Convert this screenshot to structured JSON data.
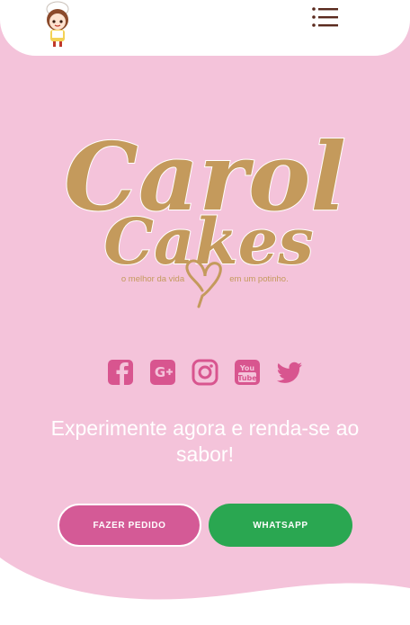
{
  "header": {
    "mascot_icon": "chef-girl-mascot-icon",
    "menu_icon": "list-menu-icon"
  },
  "logo": {
    "line1": "Carol",
    "line2": "Cakes",
    "slogan_left": "o melhor da vida",
    "slogan_right": "em um potinho."
  },
  "social": [
    {
      "name": "facebook-icon"
    },
    {
      "name": "google-plus-icon"
    },
    {
      "name": "instagram-icon"
    },
    {
      "name": "youtube-icon"
    },
    {
      "name": "twitter-icon"
    }
  ],
  "hero": {
    "tagline": "Experimente agora e renda-se ao sabor!"
  },
  "buttons": {
    "order_label": "Fazer Pedido",
    "whatsapp_label": "WhatsApp"
  },
  "colors": {
    "background": "#f4c3da",
    "accent_pink": "#d8558f",
    "gold": "#c49a5c",
    "whatsapp_green": "#2aa751",
    "menu_brown": "#5a2a1e"
  }
}
